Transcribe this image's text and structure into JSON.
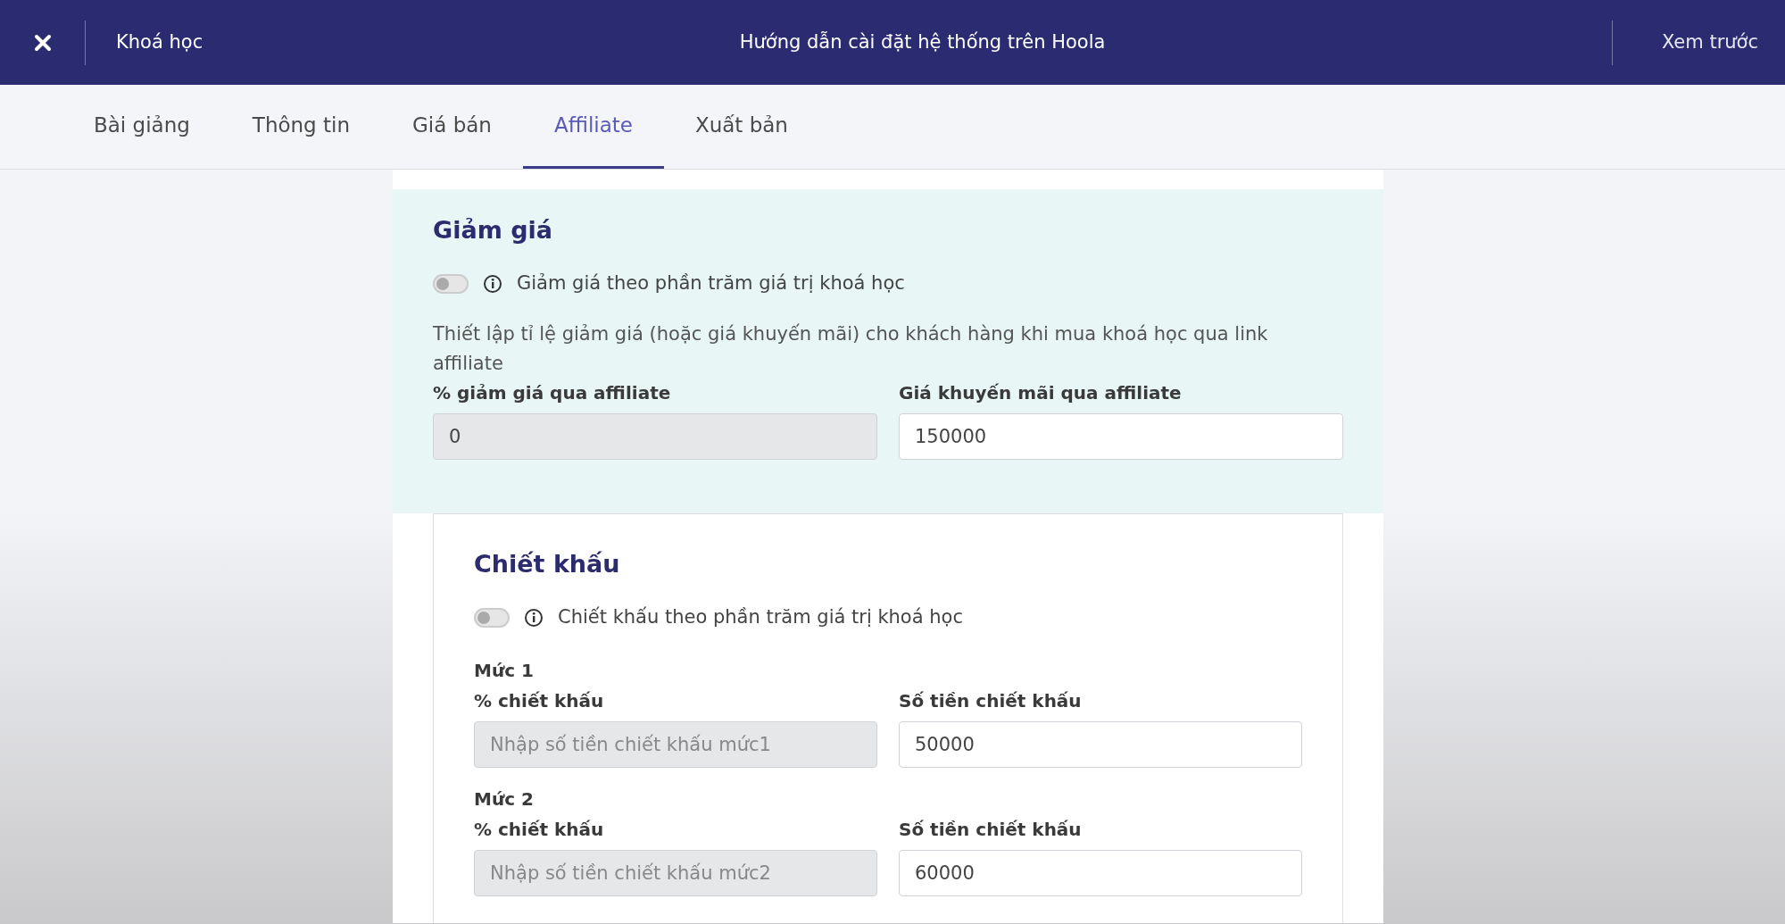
{
  "header": {
    "back_label": "Khoá học",
    "title": "Hướng dẫn cài đặt hệ thống trên Hoola",
    "preview": "Xem trước"
  },
  "tabs": [
    {
      "label": "Bài giảng",
      "selected": false
    },
    {
      "label": "Thông tin",
      "selected": false
    },
    {
      "label": "Giá bán",
      "selected": false
    },
    {
      "label": "Affiliate",
      "selected": true
    },
    {
      "label": "Xuất bản",
      "selected": false
    }
  ],
  "discount": {
    "title": "Giảm giá",
    "toggle": {
      "label": "Giảm giá theo phần trăm giá trị khoá học",
      "on": false
    },
    "description": "Thiết lập tỉ lệ giảm giá (hoặc giá khuyến mãi) cho khách hàng khi mua khoá học qua link affiliate",
    "fields": [
      {
        "label": "% giảm giá qua affiliate",
        "value": "0",
        "disabled": true
      },
      {
        "label": "Giá khuyến mãi qua affiliate",
        "value": "150000",
        "disabled": false
      }
    ]
  },
  "commission": {
    "title": "Chiết khấu",
    "toggle": {
      "label": "Chiết khấu theo phần trăm giá trị khoá học",
      "on": false
    },
    "levels": [
      {
        "title": "Mức 1",
        "fields": [
          {
            "label": "% chiết khấu",
            "placeholder": "Nhập số tiền chiết khấu mức1",
            "disabled": true
          },
          {
            "label": "Số tiền chiết khấu",
            "value": "50000",
            "disabled": false
          }
        ]
      },
      {
        "title": "Mức 2",
        "fields": [
          {
            "label": "% chiết khấu",
            "placeholder": "Nhập số tiền chiết khấu mức2",
            "disabled": true
          },
          {
            "label": "Số tiền chiết khấu",
            "value": "60000",
            "disabled": false
          }
        ]
      }
    ]
  }
}
